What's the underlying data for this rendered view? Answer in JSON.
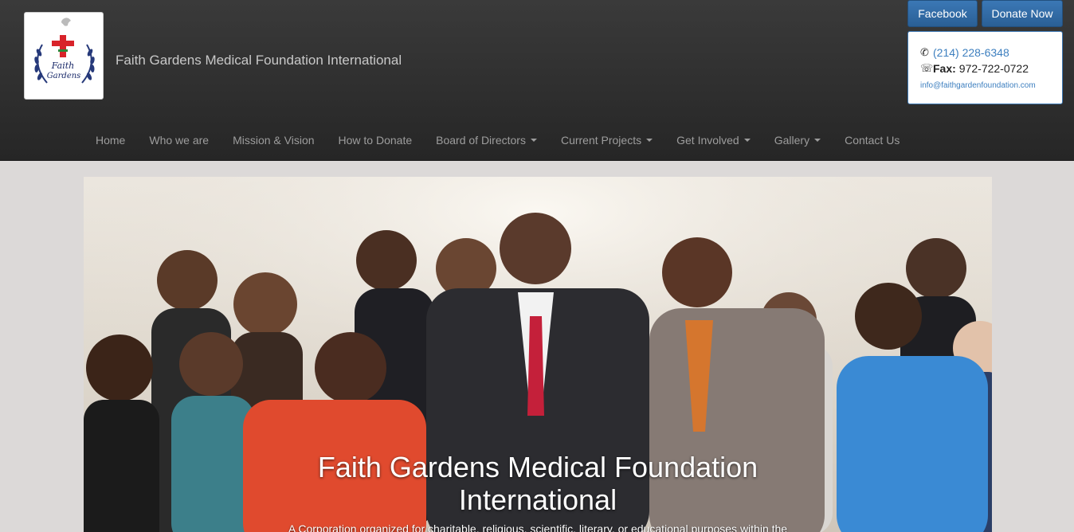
{
  "header": {
    "site_title": "Faith Gardens Medical Foundation International",
    "logo_text_top": "Faith",
    "logo_text_bottom": "Gardens"
  },
  "buttons": {
    "facebook": "Facebook",
    "donate": "Donate Now"
  },
  "contact": {
    "phone": "(214) 228-6348",
    "fax_label": "Fax:",
    "fax": "972-722-0722",
    "email": "info@faithgardenfoundation.com",
    "phone_icon": "phone-icon",
    "fax_icon": "fax-icon"
  },
  "nav": {
    "items": [
      {
        "label": "Home",
        "dropdown": false
      },
      {
        "label": "Who we are",
        "dropdown": false
      },
      {
        "label": "Mission & Vision",
        "dropdown": false
      },
      {
        "label": "How to Donate",
        "dropdown": false
      },
      {
        "label": "Board of Directors",
        "dropdown": true
      },
      {
        "label": "Current Projects",
        "dropdown": true
      },
      {
        "label": "Get Involved",
        "dropdown": true
      },
      {
        "label": "Gallery",
        "dropdown": true
      },
      {
        "label": "Contact Us",
        "dropdown": false
      }
    ]
  },
  "hero": {
    "title_line1": "Faith Gardens Medical Foundation",
    "title_line2": "International",
    "caption": "A Corporation organized for charitable, religious, scientific, literary, or educational purposes within the"
  },
  "colors": {
    "header_bg": "#2e2e2e",
    "button_blue": "#2f6aa6",
    "link_blue": "#3d7fbf",
    "page_bg": "#dcd9d8"
  }
}
